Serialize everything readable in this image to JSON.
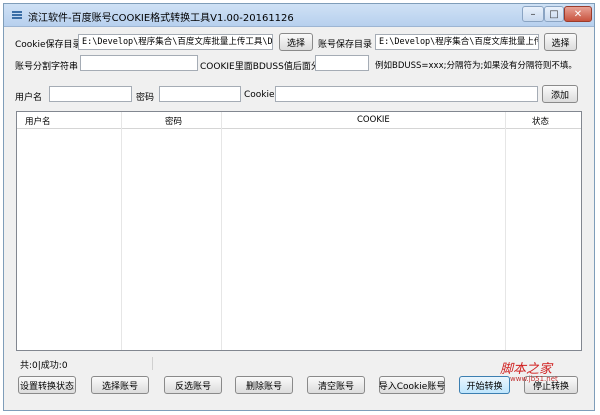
{
  "window": {
    "title": "滨江软件-百度账号COOKIE格式转换工具V1.00-20161126",
    "minimize": "–",
    "maximize": "□",
    "close": "✕"
  },
  "form": {
    "cookie_dir_label": "Cookie保存目录",
    "cookie_dir_value": "E:\\Develop\\程序集合\\百度文库批量上传工具\\Data",
    "cookie_dir_button": "选择",
    "account_dir_label": "账号保存目录",
    "account_dir_value": "E:\\Develop\\程序集合\\百度文库批量上传工具\\",
    "account_dir_button": "选择",
    "separator_label": "账号分割字符串",
    "separator_value": "",
    "bduss_sep_label": "COOKIE里面BDUSS值后面分隔符",
    "bduss_sep_value": "",
    "bduss_hint": "例如BDUSS=xxx;分隔符为;如果没有分隔符则不填。",
    "username_label": "用户名",
    "username_value": "",
    "password_label": "密码",
    "password_value": "",
    "cookie_label": "Cookie",
    "cookie_value": "",
    "add_button": "添加"
  },
  "table": {
    "columns": [
      "用户名",
      "密码",
      "COOKIE",
      "状态"
    ],
    "rows": []
  },
  "status": {
    "text": "共:0|成功:0"
  },
  "actions": {
    "set_status": "设置转换状态",
    "select_accounts": "选择账号",
    "invert_select": "反选账号",
    "delete_accounts": "删除账号",
    "clear_accounts": "清空账号",
    "import_cookie": "导入Cookie账号",
    "start": "开始转换",
    "stop": "停止转换"
  },
  "watermark": {
    "text": "脚本之家",
    "url": "www.jb51.net"
  },
  "colors": {
    "titlebar": "#c4d9f1",
    "border": "#7f9db9",
    "background": "#f0f0f0",
    "watermark": "#d02020"
  }
}
